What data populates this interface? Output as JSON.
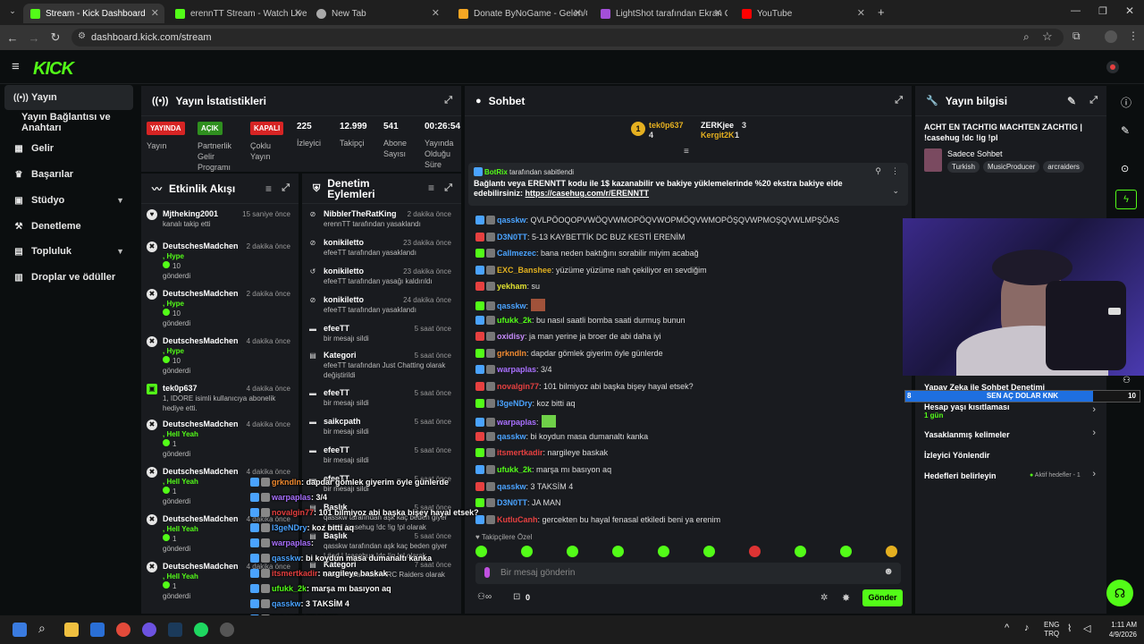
{
  "browser": {
    "tabs": [
      {
        "label": "Stream - Kick Dashboard",
        "color": "#53fc18"
      },
      {
        "label": "erennTT Stream - Watch Live o",
        "color": "#53fc18"
      },
      {
        "label": "New Tab",
        "color": "#aaaaaa"
      },
      {
        "label": "Donate ByNoGame - Gelen/Gid",
        "color": "#f5a623"
      },
      {
        "label": "LightShot tarafından Ekran Gör",
        "color": "#a34fd8"
      },
      {
        "label": "YouTube",
        "color": "#ff0000"
      }
    ],
    "url": "dashboard.kick.com/stream"
  },
  "brand": {
    "logo": "KICK",
    "accent": "#53fc18"
  },
  "sidebar": {
    "items": [
      {
        "label": "Yayın"
      },
      {
        "label": "Yayın Bağlantısı ve Anahtarı"
      },
      {
        "label": "Gelir"
      },
      {
        "label": "Başarılar"
      },
      {
        "label": "Stüdyo"
      },
      {
        "label": "Denetleme"
      },
      {
        "label": "Topluluk"
      },
      {
        "label": "Droplar ve ödüller"
      }
    ]
  },
  "stats": {
    "title": "Yayın İstatistikleri",
    "items": [
      {
        "badge": "YAYINDA",
        "badge_color": "#d62424",
        "label": "Yayın"
      },
      {
        "badge": "AÇIK",
        "badge_color": "#2f8f1f",
        "label": "Partnerlik Gelir Programı"
      },
      {
        "badge": "KAPALI",
        "badge_color": "#d62424",
        "label": "Çoklu Yayın"
      },
      {
        "value": "225",
        "label": "İzleyici"
      },
      {
        "value": "12.999",
        "label": "Takipçi"
      },
      {
        "value": "541",
        "label": "Abone Sayısı"
      },
      {
        "value": "00:26:54",
        "label": "Yayında Olduğu Süre"
      }
    ]
  },
  "activity": {
    "title": "Etkinlik Akışı",
    "rows": [
      {
        "name": "Mjtheking2001",
        "time": "15 saniye önce",
        "sub": "kanalı takip etti"
      },
      {
        "name": "DeutschesMadchen",
        "time": "2 dakika önce",
        "sub": ", Hype",
        "extra": "10",
        "extra2": "gönderdi"
      },
      {
        "name": "DeutschesMadchen",
        "time": "2 dakika önce",
        "sub": ", Hype",
        "extra": "10",
        "extra2": "gönderdi"
      },
      {
        "name": "DeutschesMadchen",
        "time": "4 dakika önce",
        "sub": ", Hype",
        "extra": "10",
        "extra2": "gönderdi"
      },
      {
        "name": "tek0p637",
        "time": "4 dakika önce",
        "sub": "1, IDORE isimli kullanıcıya abonelik hediye etti."
      },
      {
        "name": "DeutschesMadchen",
        "time": "4 dakika önce",
        "sub": ", Hell Yeah",
        "extra": "1",
        "extra2": "gönderdi"
      },
      {
        "name": "DeutschesMadchen",
        "time": "4 dakika önce",
        "sub": ", Hell Yeah",
        "extra": "1",
        "extra2": "gönderdi"
      },
      {
        "name": "DeutschesMadchen",
        "time": "4 dakika önce",
        "sub": ", Hell Yeah",
        "extra": "1",
        "extra2": "gönderdi"
      },
      {
        "name": "DeutschesMadchen",
        "time": "4 dakika önce",
        "sub": ", Hell Yeah",
        "extra": "1",
        "extra2": "gönderdi"
      }
    ]
  },
  "moderation": {
    "title": "Denetim Eylemleri",
    "rows": [
      {
        "name": "NibblerTheRatKing",
        "time": "2 dakika önce",
        "sub": "erennTT tarafından yasaklandı"
      },
      {
        "name": "konikiletto",
        "time": "23 dakika önce",
        "sub": "efeeTT tarafından yasaklandı"
      },
      {
        "name": "konikiletto",
        "time": "23 dakika önce",
        "sub": "efeeTT tarafından yasağı kaldırıldı"
      },
      {
        "name": "konikiletto",
        "time": "24 dakika önce",
        "sub": "efeeTT tarafından yasaklandı"
      },
      {
        "name": "efeeTT",
        "time": "5 saat önce",
        "sub": "bir mesajı sildi"
      },
      {
        "name": "Kategori",
        "time": "5 saat önce",
        "sub": "efeeTT tarafından Just Chatting olarak değiştirildi"
      },
      {
        "name": "efeeTT",
        "time": "5 saat önce",
        "sub": "bir mesajı sildi"
      },
      {
        "name": "saikcpath",
        "time": "5 saat önce",
        "sub": "bir mesajı sildi"
      },
      {
        "name": "efeeTT",
        "time": "5 saat önce",
        "sub": "bir mesajı sildi"
      },
      {
        "name": "efeeTT",
        "time": "5 saat önce",
        "sub": "bir mesajı sildi"
      },
      {
        "name": "Başlık",
        "time": "5 saat önce",
        "sub": "qasskw tarafından aşk kaç beden giyer | #ad | !casehug !dc !ig !pl olarak değiştirildi"
      },
      {
        "name": "Başlık",
        "time": "5 saat önce",
        "sub": "qasskw tarafından aşk kaç beden giyer | #ad | !casehug !dc !ig !pl olarak değiştirildi"
      },
      {
        "name": "Kategori",
        "time": "7 saat önce",
        "sub": "efeeTT tarafından ARC Raiders olarak"
      }
    ]
  },
  "chat": {
    "title": "Sohbet",
    "leaderboard": [
      {
        "name": "tek0p637",
        "count": "4"
      },
      {
        "name": "ZERKjee",
        "count": "3"
      },
      {
        "name": "Kergit2K",
        "count": "1"
      }
    ],
    "pinned": {
      "author": "BotRix",
      "label": "tarafından sabitlendi",
      "text": "Bağlantı veya ERENNTT kodu ile 1$ kazanabilir ve bakiye yüklemelerinde %20 ekstra bakiye elde edebilirsiniz:",
      "link": "https://casehug.com/r/ERENNTT"
    },
    "messages": [
      {
        "user": "qasskw",
        "color": "#4aa3ff",
        "text": ": QVLPÖOQOPVWÖQVWMOPÖQVWOPMÖQVWMOPÖŞQVWPMOŞQVWLMPŞÖAS"
      },
      {
        "user": "D3N0TT",
        "color": "#4aa3ff",
        "text": ": 5-13 KAYBETTİK DC BUZ KESTİ ERENİM"
      },
      {
        "user": "Callmezec",
        "color": "#4aa3ff",
        "text": ": bana neden baktığını sorabilir miyim acabağ"
      },
      {
        "user": "EXC_Banshee",
        "color": "#e0b020",
        "text": ": yüzüme yüzüme nah çekiliyor en sevdiğim"
      },
      {
        "user": "yekham",
        "color": "#e0e030",
        "text": ": su"
      },
      {
        "user": "qasskw",
        "color": "#4aa3ff",
        "text": ":"
      },
      {
        "user": "ufukk_2k",
        "color": "#53fc18",
        "text": ": bu nasıl saatli bomba saati durmuş bunun"
      },
      {
        "user": "oxidisy",
        "color": "#c58af9",
        "text": ": ja man yerine ja broer de abi daha iyi"
      },
      {
        "user": "grkndln",
        "color": "#f08a30",
        "text": ": dapdar gömlek giyerim öyle günlerde"
      },
      {
        "user": "warpaplas",
        "color": "#a970ff",
        "text": ": 3/4"
      },
      {
        "user": "novalgin77",
        "color": "#e64040",
        "text": ": 101 bilmiyoz abi başka bişey hayal etsek?"
      },
      {
        "user": "I3geNDry",
        "color": "#4aa3ff",
        "text": ": koz bitti aq"
      },
      {
        "user": "warpaplas",
        "color": "#a970ff",
        "text": ":"
      },
      {
        "user": "qasskw",
        "color": "#4aa3ff",
        "text": ": bi koydun masa dumanaltı kanka"
      },
      {
        "user": "itsmertkadir",
        "color": "#e64040",
        "text": ": nargileye baskak"
      },
      {
        "user": "ufukk_2k",
        "color": "#53fc18",
        "text": ": marşa mı basıyon aq"
      },
      {
        "user": "qasskw",
        "color": "#4aa3ff",
        "text": ": 3 TAKSİM 4"
      },
      {
        "user": "D3N0TT",
        "color": "#4aa3ff",
        "text": ": JA MAN"
      },
      {
        "user": "KutluCanh",
        "color": "#e64040",
        "text": ": gercekten bu hayal fenasal etkiledi beni ya erenim"
      }
    ],
    "followers_label": "Takipçilere Özel",
    "input_placeholder": "Bir mesaj gönderin",
    "counter": "0",
    "send_label": "Gönder"
  },
  "info": {
    "title": "Yayın bilgisi",
    "stream_title": "ACHT EN TACHTIG MACHTEN ZACHTIG | !casehug !dc !ig !pl",
    "category": "Sadece Sohbet",
    "tags": [
      "Turkish",
      "MusicProducer",
      "arcraiders"
    ],
    "settings": [
      {
        "label": "Yapay Zeka ile Sohbet Denetimi",
        "sub": ""
      },
      {
        "label": "Hesap yaşı kısıtlaması",
        "sub": "1 gün"
      },
      {
        "label": "Yasaklanmış kelimeler",
        "sub": ""
      },
      {
        "label": "İzleyici Yönlendir",
        "sub": ""
      },
      {
        "label": "Hedefleri belirleyin",
        "sub": "Aktif hedefler - 1"
      }
    ]
  },
  "goal": {
    "left": "8",
    "label": "SEN AÇ DOLAR KNK",
    "right": "10",
    "progress": 0.8
  },
  "overlay_chat": [
    {
      "user": "grkndln",
      "color": "#f08a30",
      "text": ": dapdar gömlek giyerim öyle günlerde"
    },
    {
      "user": "warpaplas",
      "color": "#a970ff",
      "text": ": 3/4"
    },
    {
      "user": "novalgin77",
      "color": "#e64040",
      "text": ": 101 bilmiyoz abi başka bişey hayal etsek?"
    },
    {
      "user": "I3geNDry",
      "color": "#4aa3ff",
      "text": ": koz bitti aq"
    },
    {
      "user": "warpaplas",
      "color": "#a970ff",
      "text": ":"
    },
    {
      "user": "qasskw",
      "color": "#4aa3ff",
      "text": ": bi koydun masa dumanaltı kanka"
    },
    {
      "user": "itsmertkadir",
      "color": "#e64040",
      "text": ": nargileye baskak"
    },
    {
      "user": "ufukk_2k",
      "color": "#53fc18",
      "text": ": marşa mı basıyon aq"
    },
    {
      "user": "qasskw",
      "color": "#4aa3ff",
      "text": ": 3 TAKSİM 4"
    },
    {
      "user": "D3N0TT",
      "color": "#4aa3ff",
      "text": ": JA MAN"
    },
    {
      "user": "KutluCanh",
      "color": "#e64040",
      "text": ": gercekten bu hayal fenasal etkiledi beni ya erenim"
    }
  ],
  "taskbar": {
    "lang1": "ENG",
    "lang2": "TRQ",
    "time": "1:11 AM",
    "date": "4/9/2026"
  }
}
